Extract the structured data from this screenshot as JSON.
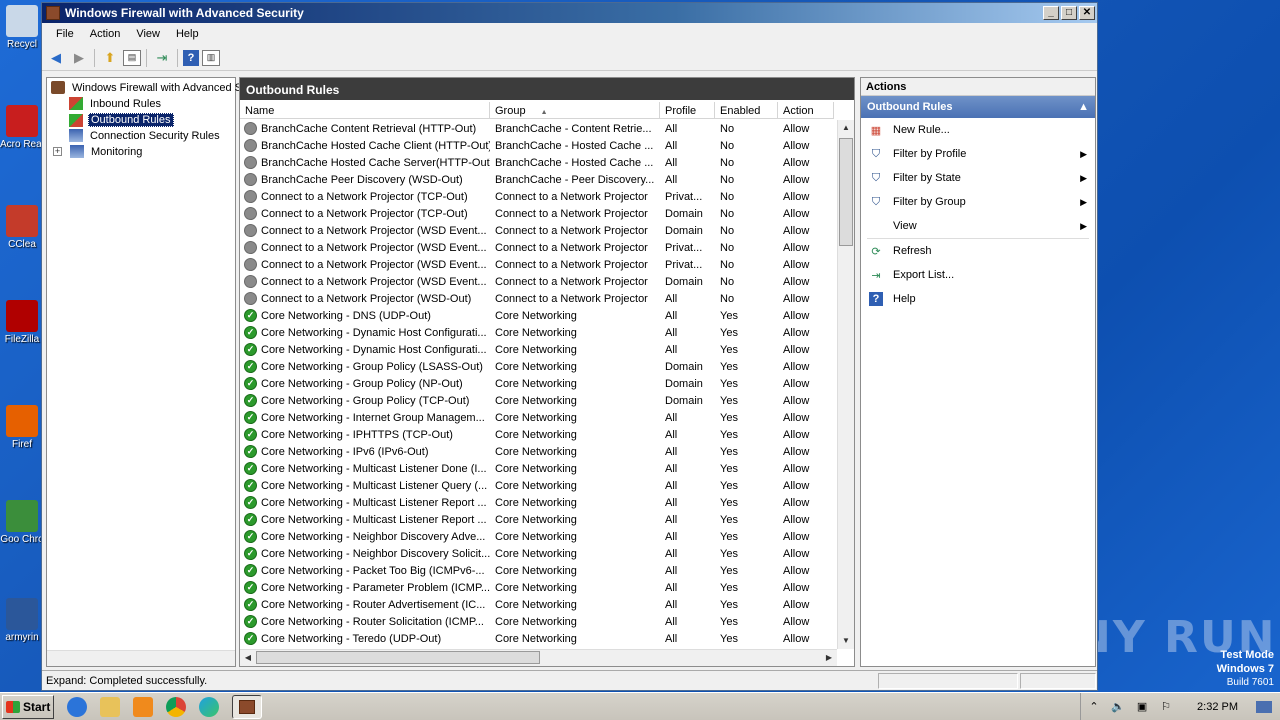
{
  "desktop": {
    "icons": [
      {
        "label": "Recycl",
        "color": "#c9d8e8"
      },
      {
        "label": "Acro Reade",
        "color": "#c81e1e"
      },
      {
        "label": "CClea",
        "color": "#c43b2a"
      },
      {
        "label": "FileZilla",
        "color": "#b00000"
      },
      {
        "label": "Firef",
        "color": "#e66000"
      },
      {
        "label": "Goo Chro",
        "color": "#3b8e3b"
      },
      {
        "label": "armyrin",
        "color": "#2b579a"
      }
    ],
    "watermark": "ANY RUN",
    "testmode": {
      "line1": "Test Mode",
      "line2": "Windows 7",
      "line3": "Build 7601"
    }
  },
  "window": {
    "title": "Windows Firewall with Advanced Security",
    "controls": {
      "min": "_",
      "max": "□",
      "close": "✕"
    }
  },
  "menu": [
    "File",
    "Action",
    "View",
    "Help"
  ],
  "tree": {
    "root": "Windows Firewall with Advanced S",
    "items": [
      "Inbound Rules",
      "Outbound Rules",
      "Connection Security Rules",
      "Monitoring"
    ],
    "selected": "Outbound Rules"
  },
  "center": {
    "title": "Outbound Rules",
    "columns": [
      "Name",
      "Group",
      "Profile",
      "Enabled",
      "Action"
    ],
    "sort_indicator": "▲",
    "rows": [
      {
        "name": "BranchCache Content Retrieval (HTTP-Out)",
        "group": "BranchCache - Content Retrie...",
        "profile": "All",
        "enabled": "No",
        "action": "Allow"
      },
      {
        "name": "BranchCache Hosted Cache Client (HTTP-Out)",
        "group": "BranchCache - Hosted Cache ...",
        "profile": "All",
        "enabled": "No",
        "action": "Allow"
      },
      {
        "name": "BranchCache Hosted Cache Server(HTTP-Out)",
        "group": "BranchCache - Hosted Cache ...",
        "profile": "All",
        "enabled": "No",
        "action": "Allow"
      },
      {
        "name": "BranchCache Peer Discovery (WSD-Out)",
        "group": "BranchCache - Peer Discovery...",
        "profile": "All",
        "enabled": "No",
        "action": "Allow"
      },
      {
        "name": "Connect to a Network Projector (TCP-Out)",
        "group": "Connect to a Network Projector",
        "profile": "Privat...",
        "enabled": "No",
        "action": "Allow"
      },
      {
        "name": "Connect to a Network Projector (TCP-Out)",
        "group": "Connect to a Network Projector",
        "profile": "Domain",
        "enabled": "No",
        "action": "Allow"
      },
      {
        "name": "Connect to a Network Projector (WSD Event...",
        "group": "Connect to a Network Projector",
        "profile": "Domain",
        "enabled": "No",
        "action": "Allow"
      },
      {
        "name": "Connect to a Network Projector (WSD Event...",
        "group": "Connect to a Network Projector",
        "profile": "Privat...",
        "enabled": "No",
        "action": "Allow"
      },
      {
        "name": "Connect to a Network Projector (WSD Event...",
        "group": "Connect to a Network Projector",
        "profile": "Privat...",
        "enabled": "No",
        "action": "Allow"
      },
      {
        "name": "Connect to a Network Projector (WSD Event...",
        "group": "Connect to a Network Projector",
        "profile": "Domain",
        "enabled": "No",
        "action": "Allow"
      },
      {
        "name": "Connect to a Network Projector (WSD-Out)",
        "group": "Connect to a Network Projector",
        "profile": "All",
        "enabled": "No",
        "action": "Allow"
      },
      {
        "name": "Core Networking - DNS (UDP-Out)",
        "group": "Core Networking",
        "profile": "All",
        "enabled": "Yes",
        "action": "Allow"
      },
      {
        "name": "Core Networking - Dynamic Host Configurati...",
        "group": "Core Networking",
        "profile": "All",
        "enabled": "Yes",
        "action": "Allow"
      },
      {
        "name": "Core Networking - Dynamic Host Configurati...",
        "group": "Core Networking",
        "profile": "All",
        "enabled": "Yes",
        "action": "Allow"
      },
      {
        "name": "Core Networking - Group Policy (LSASS-Out)",
        "group": "Core Networking",
        "profile": "Domain",
        "enabled": "Yes",
        "action": "Allow"
      },
      {
        "name": "Core Networking - Group Policy (NP-Out)",
        "group": "Core Networking",
        "profile": "Domain",
        "enabled": "Yes",
        "action": "Allow"
      },
      {
        "name": "Core Networking - Group Policy (TCP-Out)",
        "group": "Core Networking",
        "profile": "Domain",
        "enabled": "Yes",
        "action": "Allow"
      },
      {
        "name": "Core Networking - Internet Group Managem...",
        "group": "Core Networking",
        "profile": "All",
        "enabled": "Yes",
        "action": "Allow"
      },
      {
        "name": "Core Networking - IPHTTPS (TCP-Out)",
        "group": "Core Networking",
        "profile": "All",
        "enabled": "Yes",
        "action": "Allow"
      },
      {
        "name": "Core Networking - IPv6 (IPv6-Out)",
        "group": "Core Networking",
        "profile": "All",
        "enabled": "Yes",
        "action": "Allow"
      },
      {
        "name": "Core Networking - Multicast Listener Done (I...",
        "group": "Core Networking",
        "profile": "All",
        "enabled": "Yes",
        "action": "Allow"
      },
      {
        "name": "Core Networking - Multicast Listener Query (...",
        "group": "Core Networking",
        "profile": "All",
        "enabled": "Yes",
        "action": "Allow"
      },
      {
        "name": "Core Networking - Multicast Listener Report ...",
        "group": "Core Networking",
        "profile": "All",
        "enabled": "Yes",
        "action": "Allow"
      },
      {
        "name": "Core Networking - Multicast Listener Report ...",
        "group": "Core Networking",
        "profile": "All",
        "enabled": "Yes",
        "action": "Allow"
      },
      {
        "name": "Core Networking - Neighbor Discovery Adve...",
        "group": "Core Networking",
        "profile": "All",
        "enabled": "Yes",
        "action": "Allow"
      },
      {
        "name": "Core Networking - Neighbor Discovery Solicit...",
        "group": "Core Networking",
        "profile": "All",
        "enabled": "Yes",
        "action": "Allow"
      },
      {
        "name": "Core Networking - Packet Too Big (ICMPv6-...",
        "group": "Core Networking",
        "profile": "All",
        "enabled": "Yes",
        "action": "Allow"
      },
      {
        "name": "Core Networking - Parameter Problem (ICMP...",
        "group": "Core Networking",
        "profile": "All",
        "enabled": "Yes",
        "action": "Allow"
      },
      {
        "name": "Core Networking - Router Advertisement (IC...",
        "group": "Core Networking",
        "profile": "All",
        "enabled": "Yes",
        "action": "Allow"
      },
      {
        "name": "Core Networking - Router Solicitation (ICMP...",
        "group": "Core Networking",
        "profile": "All",
        "enabled": "Yes",
        "action": "Allow"
      },
      {
        "name": "Core Networking - Teredo (UDP-Out)",
        "group": "Core Networking",
        "profile": "All",
        "enabled": "Yes",
        "action": "Allow"
      }
    ]
  },
  "actions": {
    "title": "Actions",
    "section": "Outbound Rules",
    "items": [
      {
        "label": "New Rule...",
        "icon": "new-rule-icon",
        "submenu": false
      },
      {
        "label": "Filter by Profile",
        "icon": "filter-icon",
        "submenu": true
      },
      {
        "label": "Filter by State",
        "icon": "filter-icon",
        "submenu": true
      },
      {
        "label": "Filter by Group",
        "icon": "filter-icon",
        "submenu": true
      },
      {
        "label": "View",
        "icon": "",
        "submenu": true
      },
      {
        "label": "Refresh",
        "icon": "refresh-icon",
        "submenu": false
      },
      {
        "label": "Export List...",
        "icon": "export-icon",
        "submenu": false
      },
      {
        "label": "Help",
        "icon": "help-icon",
        "submenu": false
      }
    ]
  },
  "statusbar": {
    "text": "Expand:  Completed successfully."
  },
  "taskbar": {
    "start": "Start",
    "clock": "2:32 PM"
  },
  "colors": {
    "enabled_rule": "#2c9a2c",
    "disabled_rule": "#8a8a8a",
    "selection": "#0a246a",
    "pane_header": "#3c3c3c"
  }
}
